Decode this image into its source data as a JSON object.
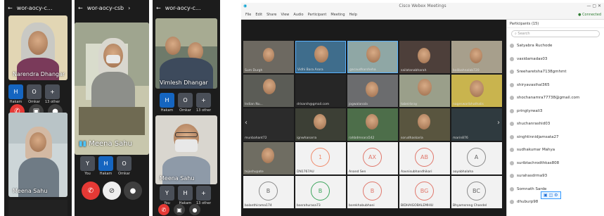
{
  "phone1": {
    "status_title": "wor-aocy-c...",
    "top_name": "Narendra Dhangar",
    "strip": [
      {
        "label": "Hakam",
        "initial": "H"
      },
      {
        "label": "Omkar",
        "initial": "O"
      },
      {
        "label": "13 others",
        "initial": "+"
      }
    ],
    "bottom_name": "Meena Sahu"
  },
  "phone2": {
    "status_title": "wor-aocy-csb",
    "main_name": "Meena Sahu",
    "strip": [
      {
        "label": "You",
        "initial": "Y"
      },
      {
        "label": "Hakam",
        "initial": "H"
      },
      {
        "label": "Omkar",
        "initial": "O"
      },
      {
        "label": "13",
        "initial": "+"
      }
    ]
  },
  "phone3": {
    "status_title": "wor-aocy-c...",
    "top_name": "Vimlesh Dhangar",
    "strip": [
      {
        "label": "Hakam",
        "initial": "H"
      },
      {
        "label": "Omkar",
        "initial": "O"
      },
      {
        "label": "13 others",
        "initial": "+"
      }
    ],
    "bottom_name": "Meena Sahu",
    "strip2": [
      {
        "label": "You",
        "initial": "Y"
      },
      {
        "label": "Hakam",
        "initial": "H"
      },
      {
        "label": "13 others",
        "initial": "+"
      }
    ]
  },
  "webex": {
    "window_title": "Cisco Webex Meetings",
    "connected": "Connected",
    "menu": [
      "File",
      "Edit",
      "Share",
      "View",
      "Audio",
      "Participant",
      "Meeting",
      "Help"
    ],
    "tiles_row1": [
      "Sum Durgh",
      "Vidhi Bara Arora",
      "gacaudharsheha",
      "sailatanabharah",
      "balibahnalab720"
    ],
    "tiles_row2": [
      "Indian Nu...",
      "drisarsh@gmail.com",
      "jogwalanala",
      "tabeirbray",
      "nageswaribhathalis"
    ],
    "tiles_row3": [
      "munbahant72",
      "ignwhanarra",
      "rahbdmnara542",
      "sorudhaskaria",
      "marin876"
    ],
    "tiles_row4": [
      "tejoshupate",
      "DN1767AU",
      "Anand Sen",
      "Aavnisubhandhikari",
      "aayabhalaha"
    ],
    "tiles_row5": [
      "balanthirama174",
      "basrahurasa73",
      "borekhabubhani",
      "BIDHAIGOBALEMHIU",
      "Bhyamsreng Chandel"
    ],
    "avatars_row4": [
      "1",
      "AX",
      "AB",
      "A"
    ],
    "avatars_row5": [
      "B",
      "B",
      "B",
      "BG",
      "BC"
    ],
    "participants_header": "Participants (15)",
    "search_placeholder": "Search",
    "participants": [
      "Satyabra Ruchode",
      "vasidamadas03",
      "Sreeharetsha7138gmhmt",
      "shiryavasihal365",
      "shochanamra77738@gmail.com",
      "pringtyrwali3",
      "shuchanrashid03",
      "singhtinnidjamsata27",
      "sudhakumar Mahya",
      "suribtachrodthkas808",
      "surahasdrma93",
      "Somnath Sarde",
      "dhuburp98"
    ]
  }
}
